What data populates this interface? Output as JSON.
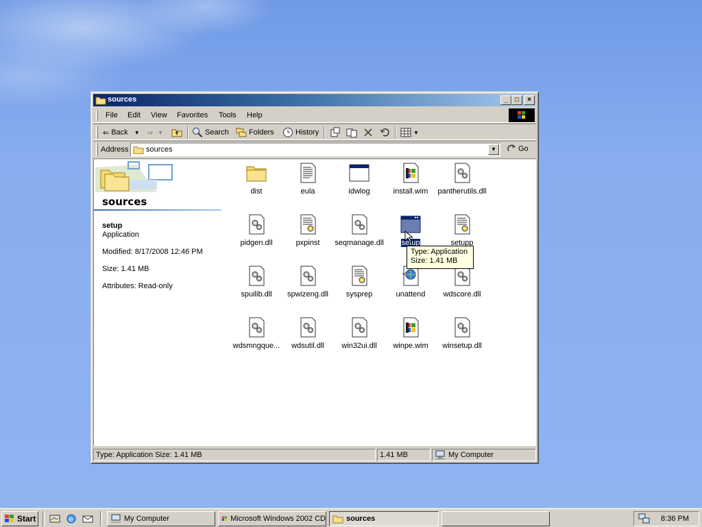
{
  "window": {
    "title": "sources",
    "menu": [
      "File",
      "Edit",
      "View",
      "Favorites",
      "Tools",
      "Help"
    ],
    "toolbar": {
      "back": "Back",
      "search": "Search",
      "folders": "Folders",
      "history": "History"
    },
    "address": {
      "label": "Address",
      "value": "sources",
      "go": "Go"
    }
  },
  "leftpane": {
    "folder_title": "sources",
    "selected_name": "setup",
    "selected_type": "Application",
    "modified": "Modified: 8/17/2008 12:46 PM",
    "size": "Size: 1.41 MB",
    "attributes": "Attributes: Read-only"
  },
  "files": [
    {
      "name": "dist",
      "icon": "folder-icon"
    },
    {
      "name": "eula",
      "icon": "text-document-icon"
    },
    {
      "name": "idwlog",
      "icon": "application-window-icon"
    },
    {
      "name": "install.wim",
      "icon": "windows-file-icon"
    },
    {
      "name": "pantherutils.dll",
      "icon": "dll-gear-icon"
    },
    {
      "name": "pidgen.dll",
      "icon": "dll-gear-icon"
    },
    {
      "name": "pxpinst",
      "icon": "setup-info-icon"
    },
    {
      "name": "seqmanage.dll",
      "icon": "dll-gear-icon"
    },
    {
      "name": "setup",
      "icon": "setup-application-icon"
    },
    {
      "name": "setupp",
      "icon": "setup-info-icon"
    },
    {
      "name": "spuilib.dll",
      "icon": "dll-gear-icon"
    },
    {
      "name": "spwizeng.dll",
      "icon": "dll-gear-icon"
    },
    {
      "name": "sysprep",
      "icon": "setup-info-icon"
    },
    {
      "name": "unattend",
      "icon": "xml-globe-icon"
    },
    {
      "name": "wdscore.dll",
      "icon": "dll-gear-icon"
    },
    {
      "name": "wdsmngque...",
      "icon": "dll-gear-icon"
    },
    {
      "name": "wdsutil.dll",
      "icon": "dll-gear-icon"
    },
    {
      "name": "win32ui.dll",
      "icon": "dll-gear-icon"
    },
    {
      "name": "winpe.wim",
      "icon": "windows-file-icon"
    },
    {
      "name": "winsetup.dll",
      "icon": "dll-gear-icon"
    }
  ],
  "tooltip": {
    "line1": "Type: Application",
    "line2": "Size: 1.41 MB"
  },
  "statusbar": {
    "info": "Type: Application Size: 1.41 MB",
    "size": "1.41 MB",
    "zone": "My Computer"
  },
  "taskbar": {
    "start": "Start",
    "tasks": [
      {
        "label": "My Computer",
        "active": false
      },
      {
        "label": "Microsoft Windows 2002 CD",
        "active": false
      },
      {
        "label": "sources",
        "active": true
      }
    ],
    "clock": "8:36 PM"
  }
}
